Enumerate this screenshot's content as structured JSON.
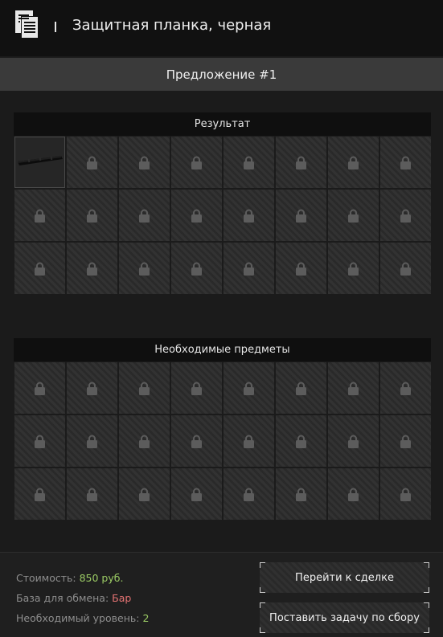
{
  "header": {
    "icon": "document-icon",
    "title": "Защитная планка, черная"
  },
  "offer": {
    "label": "Предложение #1"
  },
  "result_panel": {
    "title": "Результат",
    "rows": 3,
    "cols": 8,
    "filled_slots": [
      0
    ],
    "slot_icon": "lock-icon"
  },
  "required_panel": {
    "title": "Необходимые предметы",
    "rows": 3,
    "cols": 8,
    "filled_slots": [],
    "slot_icon": "lock-icon"
  },
  "footer": {
    "cost_label": "Стоимость:",
    "cost_value": "850 руб.",
    "base_label": "База для обмена:",
    "base_value": "Бар",
    "level_label": "Необходимый уровень:",
    "level_value": "2",
    "trade_button": "Перейти к сделке",
    "craft_button": "Поставить задачу по сбору"
  },
  "colors": {
    "green": "#9ccc65",
    "red": "#e57373"
  }
}
